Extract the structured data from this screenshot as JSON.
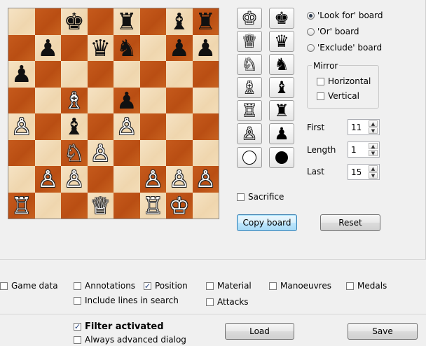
{
  "board": {
    "ranks": [
      [
        " ",
        " ",
        "bk",
        " ",
        "br",
        " ",
        "bb",
        "br"
      ],
      [
        " ",
        "bp",
        " ",
        "bq",
        "bn",
        " ",
        "bp",
        "bp"
      ],
      [
        "bp",
        " ",
        " ",
        " ",
        " ",
        " ",
        " ",
        " "
      ],
      [
        " ",
        " ",
        "wb",
        " ",
        "bp",
        " ",
        " ",
        " "
      ],
      [
        "wp",
        " ",
        "bb",
        " ",
        "wp",
        " ",
        " ",
        " "
      ],
      [
        " ",
        " ",
        "wn",
        "wp",
        " ",
        " ",
        " ",
        " "
      ],
      [
        " ",
        "wp",
        "wp",
        " ",
        " ",
        "wp",
        "wp",
        "wp"
      ],
      [
        "wr",
        " ",
        " ",
        "wq",
        " ",
        "wr",
        "wk",
        " "
      ]
    ]
  },
  "glyphs": {
    "wk": "♔",
    "wq": "♕",
    "wr": "♖",
    "wb": "♗",
    "wn": "♘",
    "wp": "♙",
    "bk": "♚",
    "bq": "♛",
    "br": "♜",
    "bb": "♝",
    "bn": "♞",
    "bp": "♟"
  },
  "palette": {
    "rows": [
      {
        "white": "wk",
        "black": "bk",
        "name": "king"
      },
      {
        "white": "wq",
        "black": "bq",
        "name": "queen"
      },
      {
        "white": "wn",
        "black": "bn",
        "name": "knight"
      },
      {
        "white": "wb",
        "black": "bb",
        "name": "bishop"
      },
      {
        "white": "wr",
        "black": "br",
        "name": "rook"
      },
      {
        "white": "wp",
        "black": "bp",
        "name": "pawn"
      },
      {
        "white": "disc",
        "black": "disc",
        "name": "any"
      }
    ]
  },
  "board_mode": {
    "options": [
      "'Look for' board",
      "'Or' board",
      "'Exclude' board"
    ],
    "selected": 0
  },
  "mirror": {
    "title": "Mirror",
    "horizontal": "Horizontal",
    "vertical": "Vertical"
  },
  "moves": {
    "first_label": "First",
    "first_value": "11",
    "length_label": "Length",
    "length_value": "1",
    "last_label": "Last",
    "last_value": "15"
  },
  "sacrifice_label": "Sacrifice",
  "buttons": {
    "copy_board": "Copy board",
    "reset": "Reset",
    "load": "Load",
    "save": "Save"
  },
  "filters": {
    "game_data": "Game data",
    "annotations": "Annotations",
    "position": "Position",
    "material": "Material",
    "manoeuvres": "Manoeuvres",
    "medals": "Medals",
    "include_lines": "Include lines in search",
    "attacks": "Attacks"
  },
  "footer": {
    "filter_activated": "Filter activated",
    "always_advanced": "Always advanced dialog"
  },
  "colors": {
    "light_square": "#f6e3c4",
    "dark_square": "#c65a1c",
    "focus_button": "#bee6fd"
  }
}
